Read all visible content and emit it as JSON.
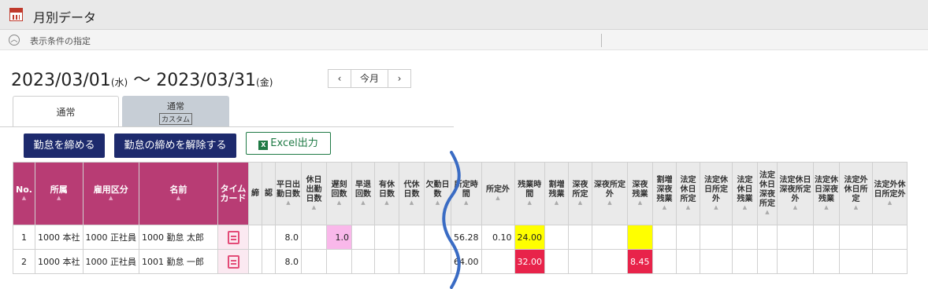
{
  "window": {
    "title": "月別データ",
    "icon": "calendar-icon"
  },
  "conditions": {
    "toggle_icon": "chevron-up-icon",
    "label": "表示条件の指定"
  },
  "period": {
    "start": "2023/03/01",
    "start_dow": "(水)",
    "separator": "〜",
    "end": "2023/03/31",
    "end_dow": "(金)"
  },
  "nav": {
    "prev": "‹",
    "today": "今月",
    "next": "›"
  },
  "tabs": [
    {
      "label": "通常",
      "sub": ""
    },
    {
      "label": "通常",
      "sub": "カスタム"
    }
  ],
  "buttons": {
    "close": "勤怠を締める",
    "unclose": "勤怠の締めを解除する",
    "excel": "Excel出力"
  },
  "table": {
    "sort_mark": "▲",
    "columns": [
      "No.",
      "所属",
      "雇用区分",
      "名前",
      "タイムカード",
      "締",
      "認",
      "平日出勤日数",
      "休日出勤日数",
      "遅刻回数",
      "早退回数",
      "有休日数",
      "代休日数",
      "欠勤日数",
      "所定時間",
      "所定外",
      "残業時間",
      "割増残業",
      "深夜所定",
      "深夜所定外",
      "深夜残業",
      "割増深夜残業",
      "法定休日所定",
      "法定休日所定外",
      "法定休日残業",
      "法定休日深夜所定",
      "法定休日深夜所定外",
      "法定休日深夜残業",
      "法定外休日所定",
      "法定外休日所定外"
    ],
    "rows": [
      {
        "no": "1",
        "dept": "1000 本社",
        "emp_type": "1000 正社員",
        "name": "1000 勤怠 太郎",
        "weekday_days": "8.0",
        "late_count": "1.0",
        "scheduled_hours": "56.28",
        "non_scheduled": "0.10",
        "overtime_hours": "24.00",
        "late_night_overtime": ""
      },
      {
        "no": "2",
        "dept": "1000 本社",
        "emp_type": "1000 正社員",
        "name": "1001 勤怠 一郎",
        "weekday_days": "8.0",
        "late_count": "",
        "scheduled_hours": "64.00",
        "non_scheduled": "",
        "overtime_hours": "32.00",
        "late_night_overtime": "8.45"
      }
    ]
  },
  "colors": {
    "header_pink": "#b83c74",
    "button_navy": "#1d2a6d",
    "excel_green": "#1f7a45",
    "highlight_yellow": "#ffff00",
    "highlight_red": "#e8234a",
    "highlight_pink": "#f9b8ea",
    "wave_blue": "#3a6cc4"
  }
}
